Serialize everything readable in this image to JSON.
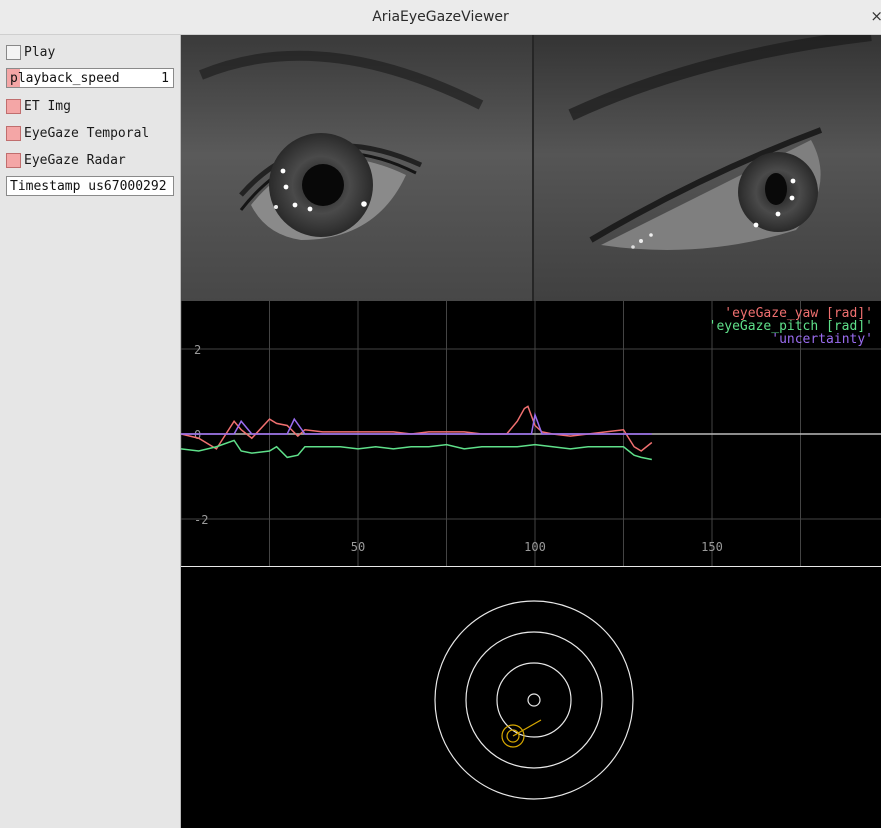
{
  "window": {
    "title": "AriaEyeGazeViewer",
    "close_glyph": "×"
  },
  "sidebar": {
    "play": {
      "label": "Play",
      "checked": false
    },
    "playback_speed": {
      "label": "playback_speed",
      "value": "1",
      "fill_fraction": 0.08
    },
    "et_img": {
      "label": "ET Img",
      "checked": true
    },
    "eyegaze_temporal": {
      "label": "EyeGaze Temporal",
      "checked": true
    },
    "eyegaze_radar": {
      "label": "EyeGaze Radar",
      "checked": true
    },
    "timestamp": {
      "value": "Timestamp us67000292"
    }
  },
  "colors": {
    "checked": "#f4a6a6",
    "yaw": "#f07070",
    "pitch": "#5fe08a",
    "uncertainty": "#9a6cf0",
    "radar_marker": "#d7a800"
  },
  "chart_data": {
    "type": "line",
    "legend_position": "top-right",
    "grid": true,
    "xlim": [
      0,
      198
    ],
    "ylim": [
      -3,
      3
    ],
    "xticks": [
      0,
      50,
      100,
      150
    ],
    "yticks": [
      -2,
      0,
      2
    ],
    "series": [
      {
        "name": "'eyeGaze_yaw [rad]'",
        "x": [
          0,
          5,
          10,
          15,
          17,
          20,
          25,
          27,
          30,
          33,
          35,
          40,
          45,
          50,
          55,
          60,
          65,
          70,
          75,
          80,
          85,
          90,
          92,
          95,
          97,
          98,
          100,
          102,
          105,
          110,
          115,
          120,
          125,
          128,
          130,
          133
        ],
        "y": [
          0,
          -0.1,
          -0.35,
          0.3,
          0.1,
          -0.1,
          0.35,
          0.25,
          0.2,
          -0.05,
          0.1,
          0.05,
          0.05,
          0.05,
          0.05,
          0.05,
          0.0,
          0.05,
          0.05,
          0.05,
          0.0,
          0.0,
          0.0,
          0.3,
          0.6,
          0.65,
          0.2,
          0.05,
          0.0,
          -0.05,
          0.0,
          0.05,
          0.1,
          -0.3,
          -0.4,
          -0.2
        ]
      },
      {
        "name": "'eyeGaze_pitch [rad]'",
        "x": [
          0,
          5,
          10,
          15,
          17,
          20,
          25,
          27,
          30,
          33,
          35,
          40,
          45,
          50,
          55,
          60,
          65,
          70,
          75,
          80,
          85,
          90,
          95,
          100,
          105,
          110,
          115,
          120,
          125,
          128,
          130,
          133
        ],
        "y": [
          -0.35,
          -0.4,
          -0.3,
          -0.15,
          -0.4,
          -0.45,
          -0.4,
          -0.3,
          -0.55,
          -0.5,
          -0.3,
          -0.3,
          -0.3,
          -0.35,
          -0.3,
          -0.35,
          -0.3,
          -0.3,
          -0.25,
          -0.35,
          -0.3,
          -0.3,
          -0.3,
          -0.25,
          -0.3,
          -0.35,
          -0.3,
          -0.3,
          -0.3,
          -0.5,
          -0.55,
          -0.6
        ]
      },
      {
        "name": "'uncertainty'",
        "x": [
          0,
          10,
          15,
          17,
          20,
          25,
          30,
          32,
          35,
          50,
          80,
          95,
          99,
          100,
          102,
          110,
          133
        ],
        "y": [
          0,
          0,
          0,
          0.3,
          0,
          0,
          0,
          0.35,
          0,
          0,
          0,
          0,
          0,
          0.45,
          0,
          0,
          0
        ]
      }
    ]
  }
}
